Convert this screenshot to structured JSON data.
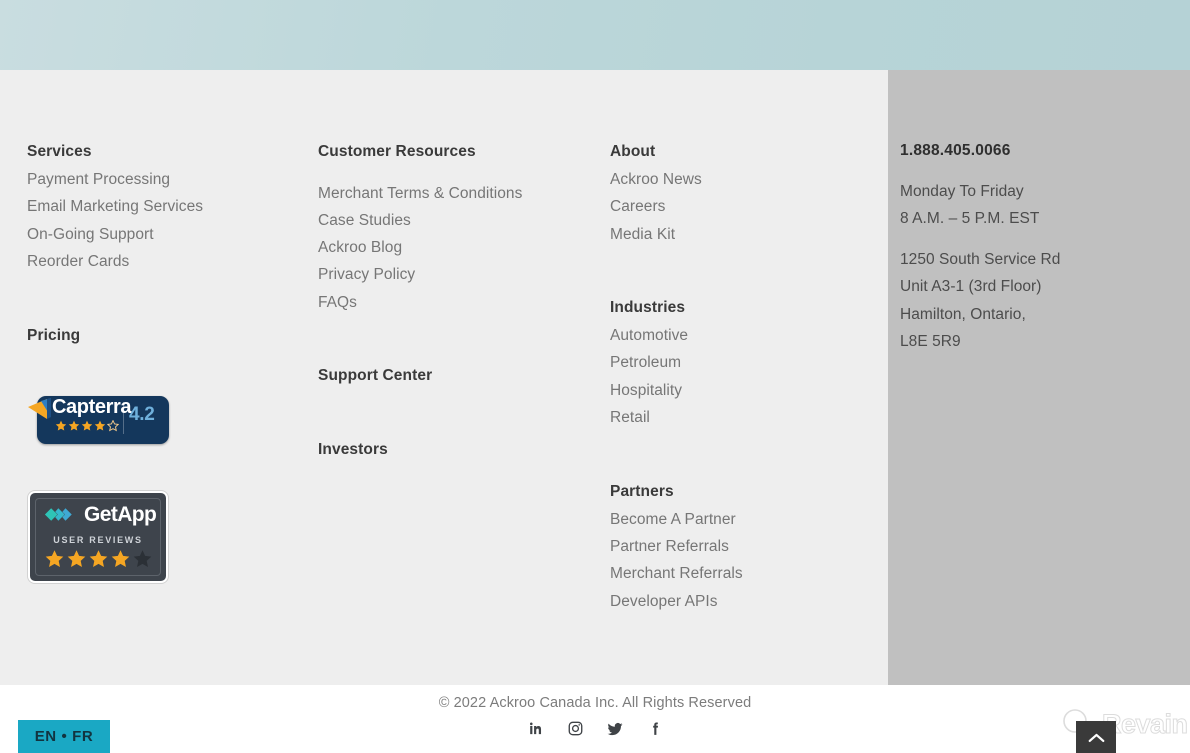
{
  "theme": {
    "hero_gradient_start": "#c9dde0",
    "hero_gradient_end": "#b5d2d6",
    "footer_bg": "#eeeeee",
    "contact_panel_bg": "#c0c0c0",
    "heading_color": "#3a3a3a",
    "link_color": "#767676",
    "lang_toggle_bg": "#1aa8c4",
    "capterra_navy": "#14375c",
    "capterra_star": "#f5a623",
    "capterra_score_color": "#6fb0dc",
    "getapp_bg": "#3e444c",
    "getapp_teal": "#2ec4b6",
    "getapp_star": "#f5a623"
  },
  "columns": {
    "services": {
      "heading": "Services",
      "links": [
        "Payment Processing",
        "Email Marketing Services",
        "On-Going Support",
        "Reorder Cards"
      ],
      "pricing_heading": "Pricing"
    },
    "resources": {
      "heading": "Customer Resources",
      "links": [
        "Merchant Terms & Conditions",
        "Case Studies",
        "Ackroo Blog",
        "Privacy Policy",
        "FAQs"
      ],
      "support_heading": "Support Center",
      "investors_heading": "Investors"
    },
    "about": {
      "heading": "About",
      "links": [
        "Ackroo News",
        "Careers",
        "Media Kit"
      ]
    },
    "industries": {
      "heading": "Industries",
      "links": [
        "Automotive",
        "Petroleum",
        "Hospitality",
        "Retail"
      ]
    },
    "partners": {
      "heading": "Partners",
      "links": [
        "Become A Partner",
        "Partner Referrals",
        "Merchant Referrals",
        "Developer APIs"
      ]
    },
    "contact": {
      "phone": "1.888.405.0066",
      "hours": [
        "Monday To Friday",
        "8 A.M. – 5 P.M. EST"
      ],
      "address": [
        "1250 South Service Rd",
        "Unit A3-1 (3rd Floor)",
        "Hamilton, Ontario,",
        "L8E 5R9"
      ]
    }
  },
  "badges": {
    "capterra": {
      "name": "Capterra",
      "score": "4.2",
      "stars_filled": 4,
      "stars_total": 5,
      "icon": "capterra-arrow-icon"
    },
    "getapp": {
      "name": "GetApp",
      "subtitle": "USER REVIEWS",
      "stars_filled": 4,
      "stars_total": 5,
      "icon": "getapp-chevrons-icon"
    }
  },
  "bottom": {
    "copyright": "© 2022  Ackroo Canada Inc.  All Rights Reserved",
    "socials": [
      {
        "name": "linkedin-icon",
        "label": "in"
      },
      {
        "name": "instagram-icon",
        "label": "Instagram"
      },
      {
        "name": "twitter-icon",
        "label": "Twitter"
      },
      {
        "name": "facebook-icon",
        "label": "f"
      }
    ]
  },
  "lang_toggle": {
    "label": "EN • FR"
  },
  "watermark": {
    "text": "Revain"
  },
  "scroll_top": {
    "icon": "chevron-up-icon"
  }
}
